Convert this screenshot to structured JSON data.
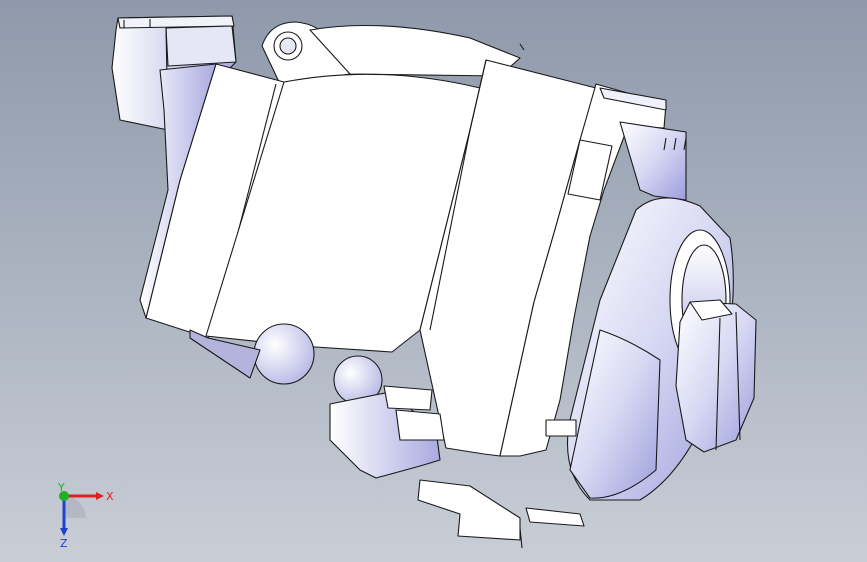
{
  "viewport": {
    "background_top": "#8e99ab",
    "background_bottom": "#c9ced6",
    "model_face_color": "#ffffff",
    "model_shade_color": "#b8b9e6",
    "model_edge_color": "#1a1a1a"
  },
  "triad": {
    "x_label": "X",
    "y_label": "Y",
    "z_label": "Z",
    "x_color": "#e02020",
    "y_color": "#20b020",
    "z_color": "#2040d0"
  }
}
